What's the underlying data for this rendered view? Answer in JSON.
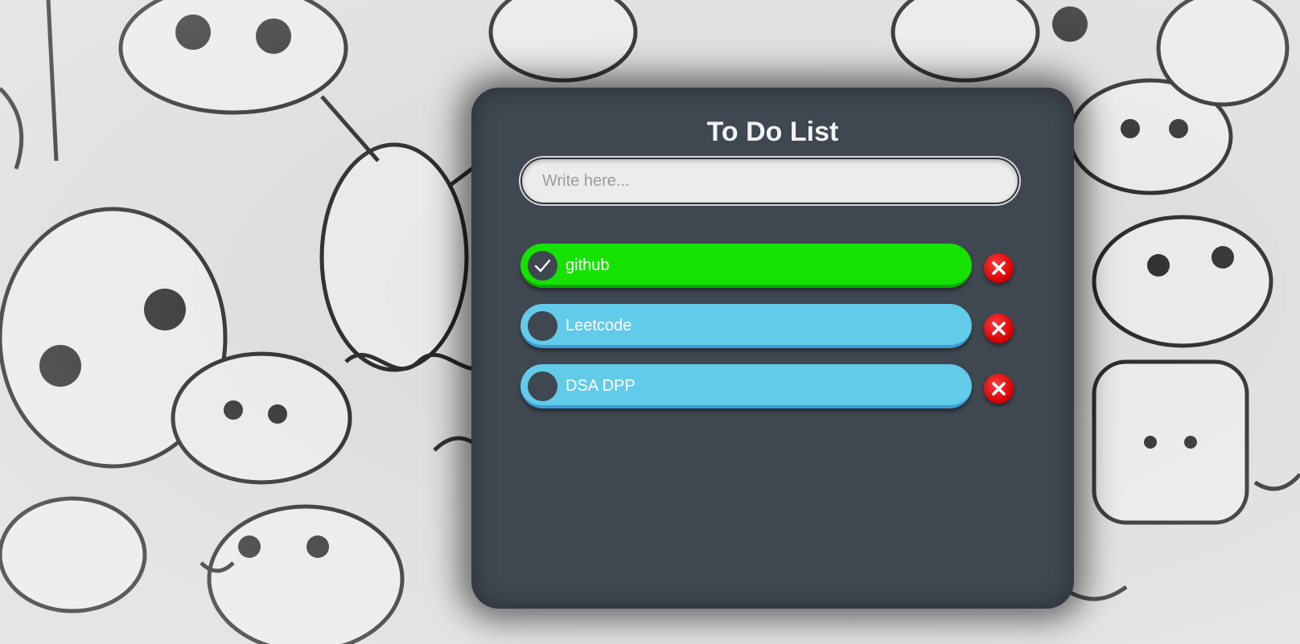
{
  "app": {
    "title": "To Do List"
  },
  "input": {
    "placeholder": "Write here...",
    "value": ""
  },
  "tasks": [
    {
      "label": "github",
      "done": true
    },
    {
      "label": "Leetcode",
      "done": false
    },
    {
      "label": "DSA DPP",
      "done": false
    }
  ],
  "colors": {
    "panel": "#3f4751",
    "done": "#16e200",
    "todo": "#62cbea",
    "delete": "#e00000"
  },
  "icons": {
    "check": "check-icon",
    "delete": "close-icon"
  }
}
